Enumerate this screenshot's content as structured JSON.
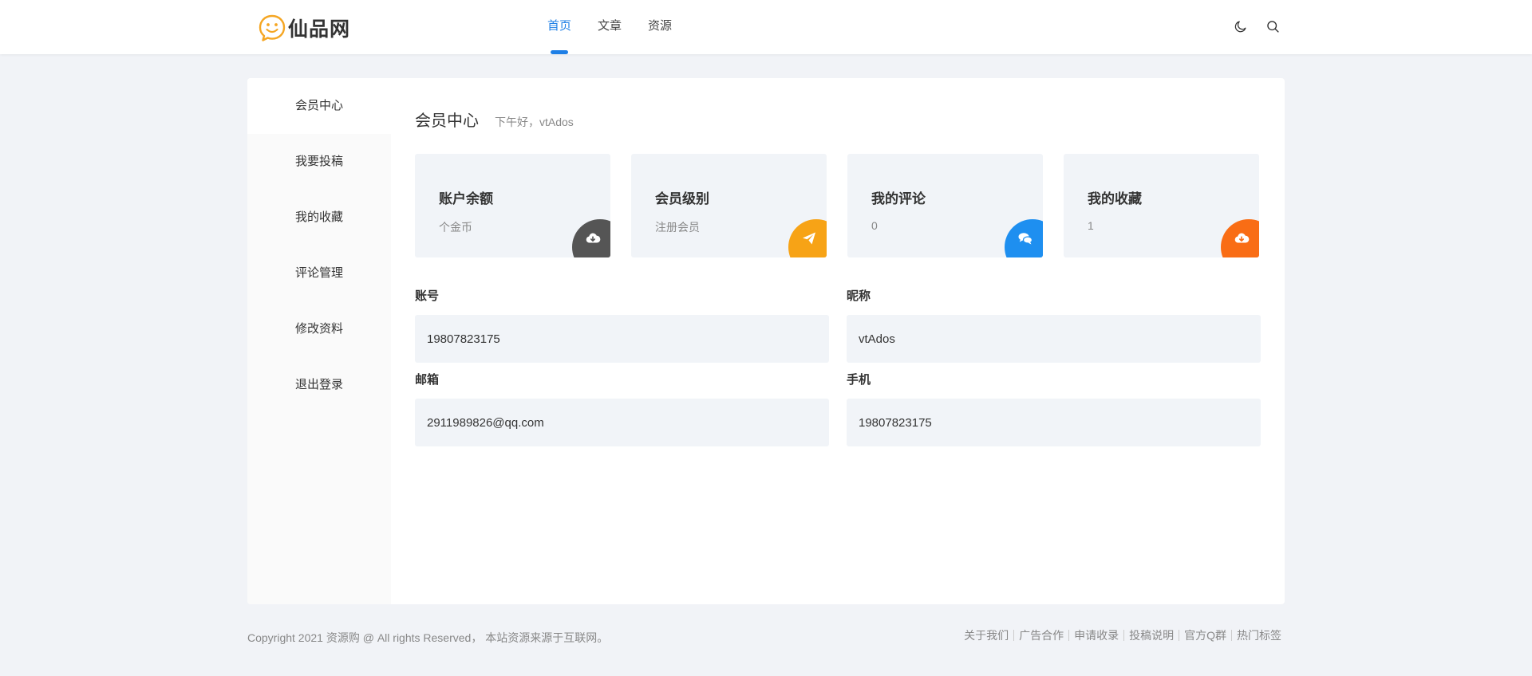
{
  "header": {
    "logo_text": "仙品网",
    "nav": [
      {
        "label": "首页",
        "active": true
      },
      {
        "label": "文章",
        "active": false
      },
      {
        "label": "资源",
        "active": false
      }
    ],
    "icons": [
      "moon-icon",
      "search-icon"
    ]
  },
  "sidebar": {
    "items": [
      {
        "label": "会员中心",
        "active": true
      },
      {
        "label": "我要投稿"
      },
      {
        "label": "我的收藏"
      },
      {
        "label": "评论管理"
      },
      {
        "label": "修改资料"
      },
      {
        "label": "退出登录"
      }
    ]
  },
  "content": {
    "title": "会员中心",
    "greeting": "下午好，vtAdos",
    "stats": [
      {
        "label": "账户余额",
        "value": "个金币",
        "icon": "cloud-download-icon",
        "color": "#555555"
      },
      {
        "label": "会员级别",
        "value": "注册会员",
        "icon": "paper-plane-icon",
        "color": "#f7a316"
      },
      {
        "label": "我的评论",
        "value": "0",
        "icon": "comments-icon",
        "color": "#1e8ff0"
      },
      {
        "label": "我的收藏",
        "value": "1",
        "icon": "cloud-download-icon",
        "color": "#f96d15"
      }
    ],
    "fields": [
      {
        "label": "账号",
        "value": "19807823175"
      },
      {
        "label": "昵称",
        "value": "vtAdos"
      },
      {
        "label": "邮箱",
        "value": "2911989826@qq.com"
      },
      {
        "label": "手机",
        "value": "19807823175"
      }
    ]
  },
  "footer": {
    "copyright": "Copyright 2021 资源购 @ All rights Reserved， 本站资源来源于互联网。",
    "links": [
      "关于我们",
      "广告合作",
      "申请收录",
      "投稿说明",
      "官方Q群",
      "热门标签"
    ]
  },
  "colors": {
    "accent": "#1e7fe6",
    "logo": "#f5a623"
  }
}
